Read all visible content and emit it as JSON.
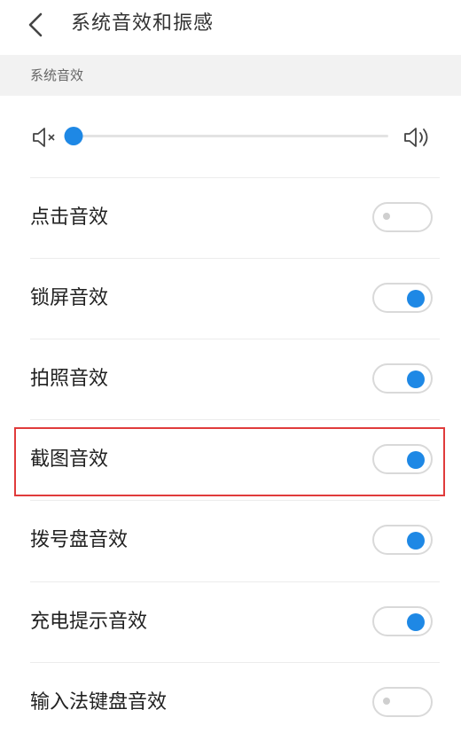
{
  "header": {
    "title": "系统音效和振感"
  },
  "section": {
    "title": "系统音效"
  },
  "volume": {
    "level": 0.0
  },
  "settings": [
    {
      "label": "点击音效",
      "on": false
    },
    {
      "label": "锁屏音效",
      "on": true
    },
    {
      "label": "拍照音效",
      "on": true
    },
    {
      "label": "截图音效",
      "on": true
    },
    {
      "label": "拨号盘音效",
      "on": true
    },
    {
      "label": "充电提示音效",
      "on": true
    },
    {
      "label": "输入法键盘音效",
      "on": false
    }
  ],
  "highlighted_item": "截图音效",
  "colors": {
    "accent": "#1e88e5",
    "highlight_border": "#e03b3b",
    "section_bg": "#f2f2f2"
  },
  "icons": [
    "back-arrow-icon",
    "volume-mute-icon",
    "volume-loud-icon"
  ]
}
